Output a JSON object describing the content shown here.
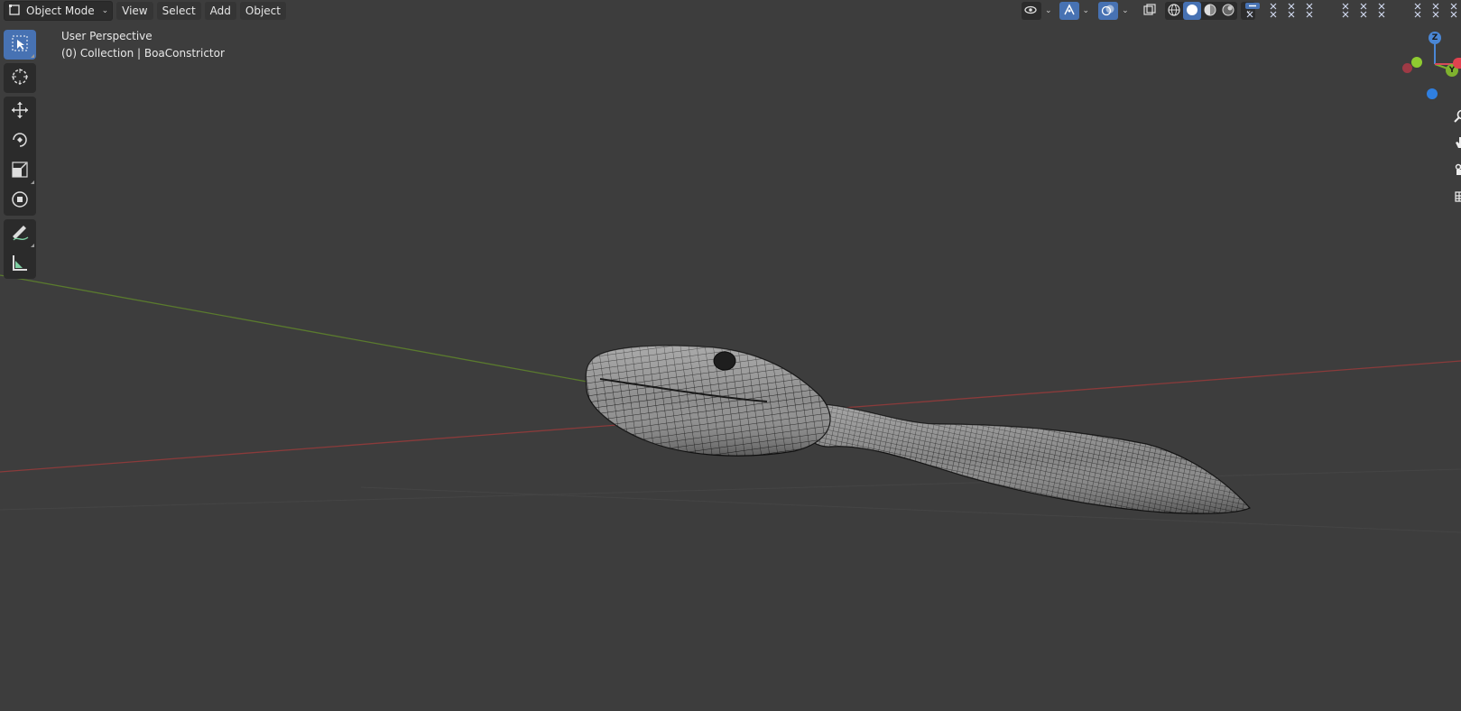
{
  "header": {
    "mode_label": "Object Mode",
    "menus": [
      "View",
      "Select",
      "Add",
      "Object"
    ]
  },
  "viewport": {
    "view_name": "User Perspective",
    "collection_info": "(0) Collection | BoaConstrictor"
  },
  "gizmo": {
    "z_label": "Z",
    "y_label": "Y"
  },
  "colors": {
    "background": "#3d3d3d",
    "accent": "#4772b3",
    "axis_x": "#8a3b3b",
    "axis_y": "#5a7a2e",
    "mesh_fill": "#8c8c8c",
    "mesh_wire": "#1e1e1e"
  },
  "icons": {
    "toolbar": [
      "select-box-icon",
      "cursor-icon",
      "move-icon",
      "rotate-icon",
      "scale-icon",
      "transform-icon",
      "annotate-icon",
      "measure-icon"
    ],
    "header_right": [
      "visibility-icon",
      "gizmo-icon",
      "overlay-icon",
      "xray-icon",
      "wireframe-shading-icon",
      "solid-shading-icon",
      "material-shading-icon",
      "rendered-shading-icon"
    ],
    "nav": [
      "zoom-icon",
      "pan-icon",
      "camera-icon",
      "ortho-grid-icon"
    ]
  }
}
